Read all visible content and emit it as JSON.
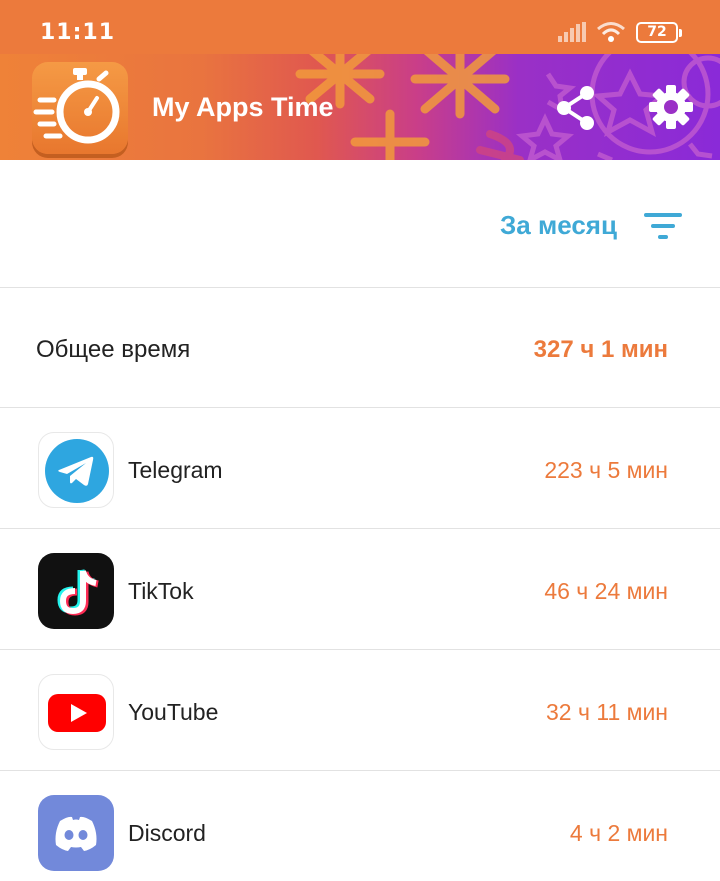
{
  "status_bar": {
    "time": "11:11",
    "battery": "72"
  },
  "header": {
    "title": "My Apps Time",
    "share_icon": "share-icon",
    "settings_icon": "gear-icon"
  },
  "filter": {
    "label": "За месяц",
    "icon": "filter-icon"
  },
  "total": {
    "label": "Общее время",
    "value": "327 ч 1 мин"
  },
  "apps": [
    {
      "name": "Telegram",
      "time": "223 ч 5 мин",
      "icon": "telegram-icon"
    },
    {
      "name": "TikTok",
      "time": "46 ч 24 мин",
      "icon": "tiktok-icon"
    },
    {
      "name": "YouTube",
      "time": "32 ч 11 мин",
      "icon": "youtube-icon"
    },
    {
      "name": "Discord",
      "time": "4 ч 2 мин",
      "icon": "discord-icon"
    }
  ],
  "colors": {
    "accent_orange": "#ec7a3c",
    "filter_blue": "#3fa9d6",
    "header_gradient_end": "#8a2ad8"
  }
}
